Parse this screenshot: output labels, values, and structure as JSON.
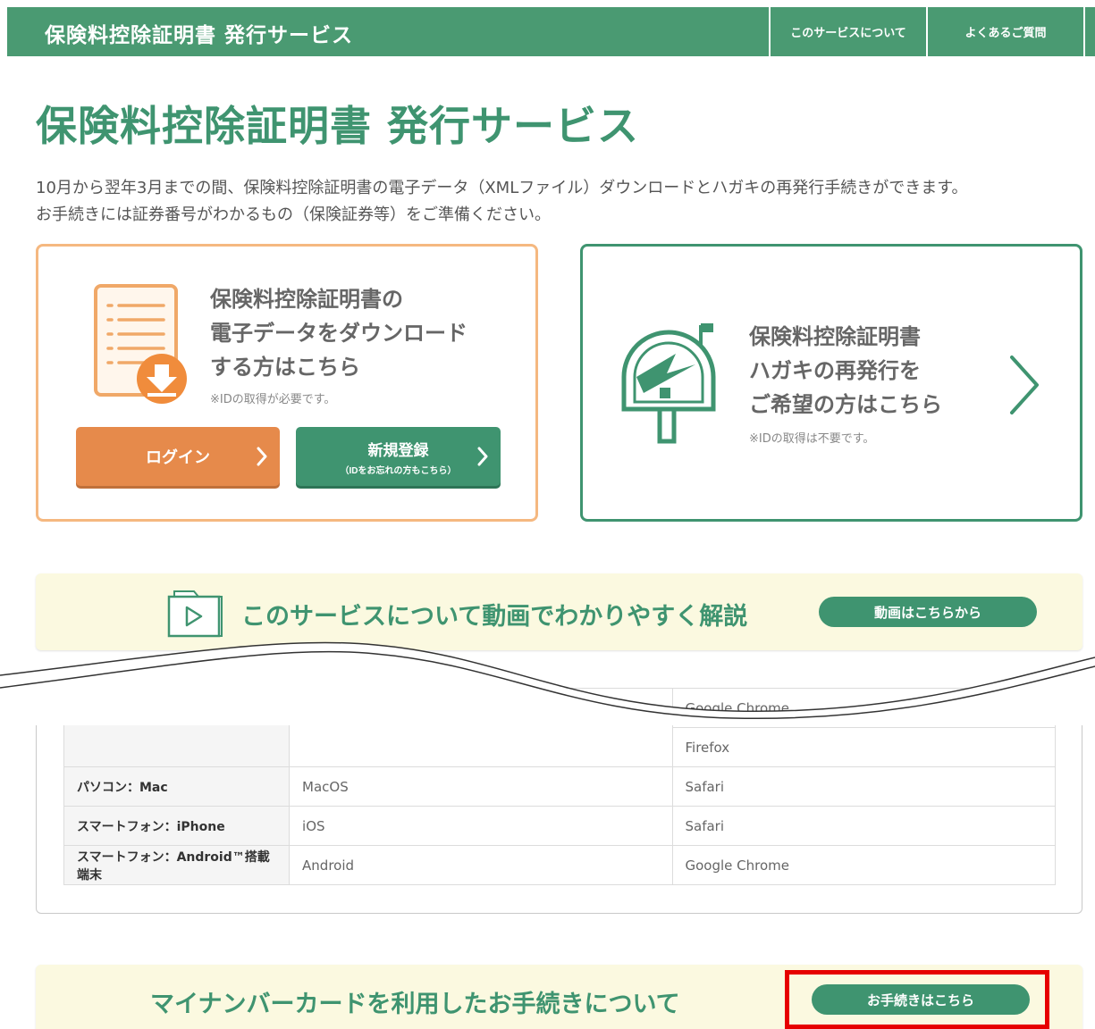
{
  "header": {
    "title": "保険料控除証明書 発行サービス",
    "nav": [
      "このサービスについて",
      "よくあるご質問"
    ]
  },
  "page": {
    "title": "保険料控除証明書 発行サービス",
    "lead_line1": "10月から翌年3月までの間、保険料控除証明書の電子データ（XMLファイル）ダウンロードとハガキの再発行手続きができます。",
    "lead_line2": "お手続きには証券番号がわかるもの（保険証券等）をご準備ください。"
  },
  "download_card": {
    "heading_line1": "保険料控除証明書の",
    "heading_line2": "電子データをダウンロード",
    "heading_line3": "する方はこちら",
    "note": "※IDの取得が必要です。",
    "login_label": "ログイン",
    "register_label": "新規登録",
    "register_sub": "（IDをお忘れの方もこちら）"
  },
  "postcard_card": {
    "heading_line1": "保険料控除証明書",
    "heading_line2": "ハガキの再発行を",
    "heading_line3": "ご希望の方はこちら",
    "note": "※IDの取得は不要です。"
  },
  "video_banner": {
    "text": "このサービスについて動画でわかりやすく解説",
    "button": "動画はこちらから"
  },
  "env_table": {
    "partial_row": {
      "browsers": [
        "Google Chrome",
        "Firefox"
      ]
    },
    "rows": [
      {
        "device": "パソコン：Mac",
        "os": "MacOS",
        "browser": "Safari"
      },
      {
        "device": "スマートフォン：iPhone",
        "os": "iOS",
        "browser": "Safari"
      },
      {
        "device": "スマートフォン：Android™搭載端末",
        "os": "Android",
        "browser": "Google Chrome"
      }
    ]
  },
  "mynumber_banner": {
    "text": "マイナンバーカードを利用したお手続きについて",
    "button": "お手続きはこちら"
  },
  "colors": {
    "brand_green": "#4a9a72",
    "accent_orange": "#e68a4b",
    "banner_bg": "#fbf9e0",
    "highlight_red": "#e60000"
  }
}
